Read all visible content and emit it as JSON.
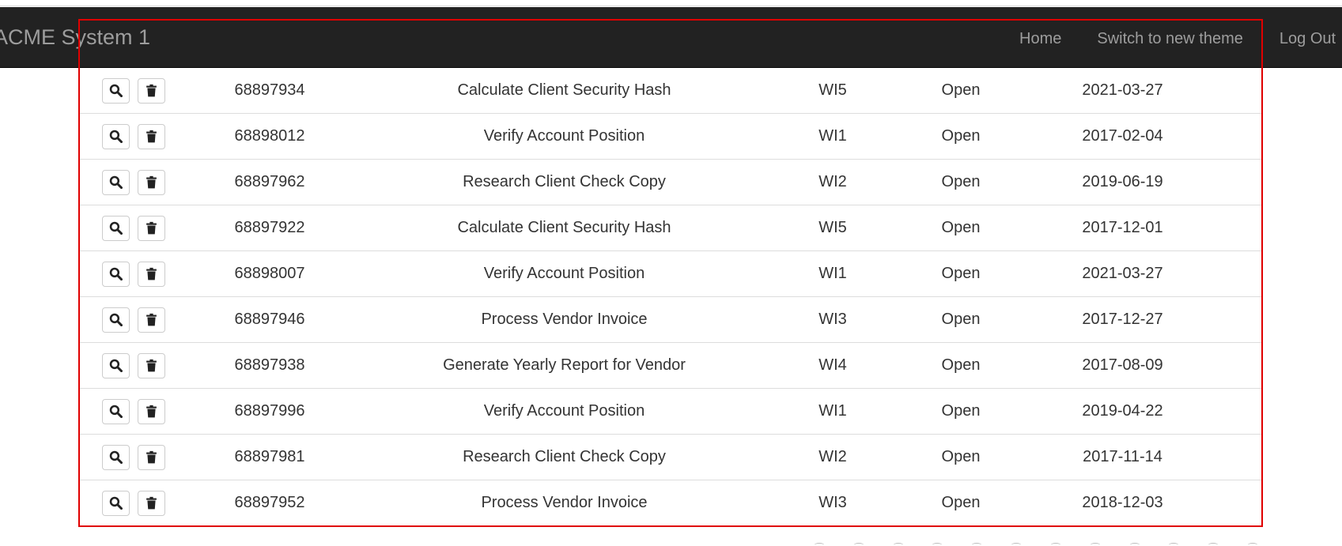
{
  "navbar": {
    "brand": "ACME System 1",
    "links": [
      {
        "label": "Home"
      },
      {
        "label": "Switch to new theme"
      },
      {
        "label": "Log Out"
      }
    ]
  },
  "icons": {
    "view": "search-icon",
    "delete": "trash-icon"
  },
  "work_items": {
    "rows": [
      {
        "id": "68897934",
        "description": "Calculate Client Security Hash",
        "type": "WI5",
        "status": "Open",
        "date": "2021-03-27"
      },
      {
        "id": "68898012",
        "description": "Verify Account Position",
        "type": "WI1",
        "status": "Open",
        "date": "2017-02-04"
      },
      {
        "id": "68897962",
        "description": "Research Client Check Copy",
        "type": "WI2",
        "status": "Open",
        "date": "2019-06-19"
      },
      {
        "id": "68897922",
        "description": "Calculate Client Security Hash",
        "type": "WI5",
        "status": "Open",
        "date": "2017-12-01"
      },
      {
        "id": "68898007",
        "description": "Verify Account Position",
        "type": "WI1",
        "status": "Open",
        "date": "2021-03-27"
      },
      {
        "id": "68897946",
        "description": "Process Vendor Invoice",
        "type": "WI3",
        "status": "Open",
        "date": "2017-12-27"
      },
      {
        "id": "68897938",
        "description": "Generate Yearly Report for Vendor",
        "type": "WI4",
        "status": "Open",
        "date": "2017-08-09"
      },
      {
        "id": "68897996",
        "description": "Verify Account Position",
        "type": "WI1",
        "status": "Open",
        "date": "2019-04-22"
      },
      {
        "id": "68897981",
        "description": "Research Client Check Copy",
        "type": "WI2",
        "status": "Open",
        "date": "2017-11-14"
      },
      {
        "id": "68897952",
        "description": "Process Vendor Invoice",
        "type": "WI3",
        "status": "Open",
        "date": "2018-12-03"
      }
    ]
  },
  "colors": {
    "navbar_bg": "#222222",
    "navbar_text": "#9d9d9d",
    "highlight": "#e00000",
    "row_border": "#dddddd"
  }
}
